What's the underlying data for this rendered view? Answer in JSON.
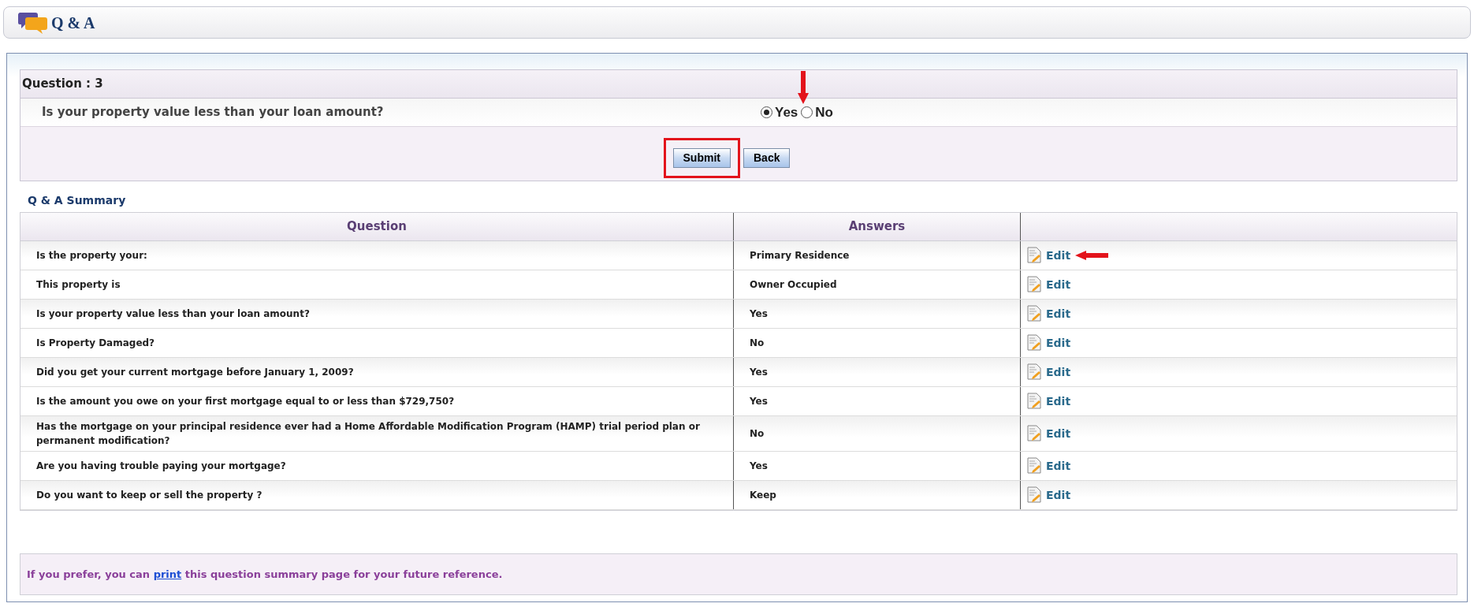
{
  "header": {
    "title": "Q & A"
  },
  "question": {
    "heading": "Question : 3",
    "text": "Is your property value less than your loan amount?",
    "pointer_arrow": true,
    "options": [
      {
        "label": "Yes",
        "selected": true
      },
      {
        "label": "No",
        "selected": false
      }
    ]
  },
  "buttons": [
    {
      "label": "Submit",
      "highlighted": true
    },
    {
      "label": "Back",
      "highlighted": false
    }
  ],
  "summary": {
    "title": "Q & A Summary",
    "columns": [
      "Question",
      "Answers"
    ],
    "rows": [
      {
        "question": "Is the property your:",
        "answer": "Primary Residence",
        "action": "Edit",
        "pointer_arrow": true
      },
      {
        "question": "This property is",
        "answer": "Owner Occupied",
        "action": "Edit",
        "pointer_arrow": false
      },
      {
        "question": "Is your property value less than your loan amount?",
        "answer": "Yes",
        "action": "Edit",
        "pointer_arrow": false
      },
      {
        "question": "Is Property Damaged?",
        "answer": "No",
        "action": "Edit",
        "pointer_arrow": false
      },
      {
        "question": "Did you get your current mortgage before January 1, 2009?",
        "answer": "Yes",
        "action": "Edit",
        "pointer_arrow": false
      },
      {
        "question": "Is the amount you owe on your first mortgage equal to or less than $729,750?",
        "answer": "Yes",
        "action": "Edit",
        "pointer_arrow": false
      },
      {
        "question": "Has the mortgage on your principal residence ever had a Home Affordable Modification Program (HAMP) trial period plan or permanent modification?",
        "answer": "No",
        "action": "Edit",
        "pointer_arrow": false
      },
      {
        "question": "Are you having trouble paying your mortgage?",
        "answer": "Yes",
        "action": "Edit",
        "pointer_arrow": false
      },
      {
        "question": "Do you want to keep or sell the property ?",
        "answer": "Keep",
        "action": "Edit",
        "pointer_arrow": false
      }
    ]
  },
  "footer": {
    "before": "If you prefer, you can",
    "link": "print",
    "after": "this question summary page for your future reference."
  }
}
